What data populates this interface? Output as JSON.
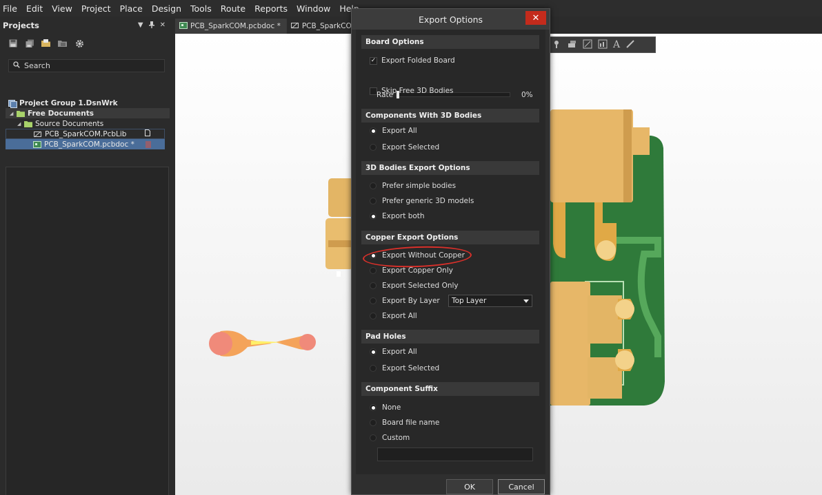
{
  "menu": [
    "File",
    "Edit",
    "View",
    "Project",
    "Place",
    "Design",
    "Tools",
    "Route",
    "Reports",
    "Window",
    "Help"
  ],
  "projects_panel": {
    "title": "Projects",
    "search_placeholder": "Search",
    "tree": {
      "group": "Project Group 1.DsnWrk",
      "free_documents": "Free Documents",
      "source_documents": "Source Documents",
      "files": [
        "PCB_SparkCOM.PcbLib",
        "PCB_SparkCOM.pcbdoc *"
      ]
    }
  },
  "tabs": [
    "PCB_SparkCOM.pcbdoc *",
    "PCB_SparkCOM.Pcl"
  ],
  "dialog": {
    "title": "Export Options",
    "close": "✕",
    "board_options": {
      "header": "Board Options",
      "export_folded": "Export Folded Board",
      "rate_label": "Rate",
      "rate_value": "0%",
      "rate_fraction": 0,
      "skip_free": "Skip Free 3D Bodies"
    },
    "components_3d": {
      "header": "Components With 3D Bodies",
      "export_all": "Export All",
      "export_selected": "Export Selected"
    },
    "bodies_export": {
      "header": "3D Bodies Export Options",
      "prefer_simple": "Prefer simple bodies",
      "prefer_generic": "Prefer generic 3D models",
      "export_both": "Export both"
    },
    "copper_export": {
      "header": "Copper Export Options",
      "without_copper": "Export Without Copper",
      "copper_only": "Export Copper Only",
      "selected_only": "Export Selected Only",
      "by_layer": "Export By Layer",
      "layer_value": "Top Layer",
      "export_all": "Export All"
    },
    "pad_holes": {
      "header": "Pad Holes",
      "export_all": "Export All",
      "export_selected": "Export Selected"
    },
    "component_suffix": {
      "header": "Component Suffix",
      "none": "None",
      "board_file_name": "Board file name",
      "custom": "Custom"
    },
    "ok": "OK",
    "cancel": "Cancel"
  },
  "colors": {
    "accent_selection": "#4a6d99",
    "close_button": "#c42b1c",
    "annotation": "#d9302a",
    "pcb_green": "#2f7a3a",
    "component_tan": "#e7b768"
  }
}
